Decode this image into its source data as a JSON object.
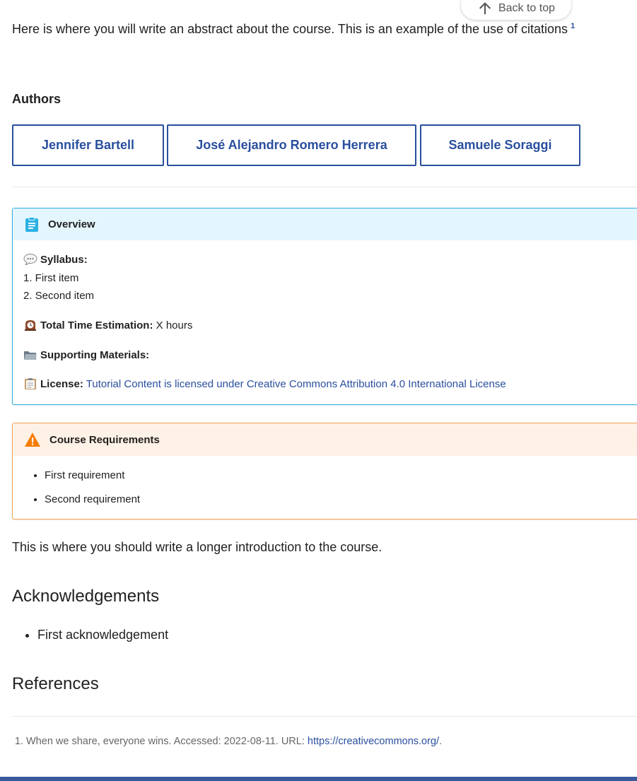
{
  "back_to_top": {
    "label": "Back to top"
  },
  "abstract": {
    "text": "Here is where you will write an abstract about the course. This is an example of the use of citations",
    "citation": "1"
  },
  "authors": {
    "heading": "Authors",
    "items": [
      "Jennifer Bartell",
      "José Alejandro Romero Herrera",
      "Samuele Soraggi"
    ]
  },
  "overview": {
    "title": "Overview",
    "syllabus_label": "Syllabus:",
    "syllabus_items": [
      "1. First item",
      "2. Second item"
    ],
    "time_label": "Total Time Estimation:",
    "time_value": "X hours",
    "materials_label": "Supporting Materials:",
    "license_label": "License:",
    "license_link": "Tutorial Content is licensed under Creative Commons Attribution 4.0 International License"
  },
  "requirements": {
    "title": "Course Requirements",
    "items": [
      "First requirement",
      "Second requirement"
    ]
  },
  "intro": {
    "text": "This is where you should write a longer introduction to the course."
  },
  "acknowledgements": {
    "heading": "Acknowledgements",
    "items": [
      "First acknowledgement"
    ]
  },
  "references": {
    "heading": "References",
    "items": [
      {
        "text": "When we share, everyone wins. Accessed: 2022-08-11. URL: ",
        "link": "https://creativecommons.org/",
        "trail": "."
      }
    ]
  },
  "colors": {
    "accent": "#2a4f9e",
    "info": "#2ab0e3",
    "warning": "#f0a050",
    "footer": "#3a5a9c"
  }
}
